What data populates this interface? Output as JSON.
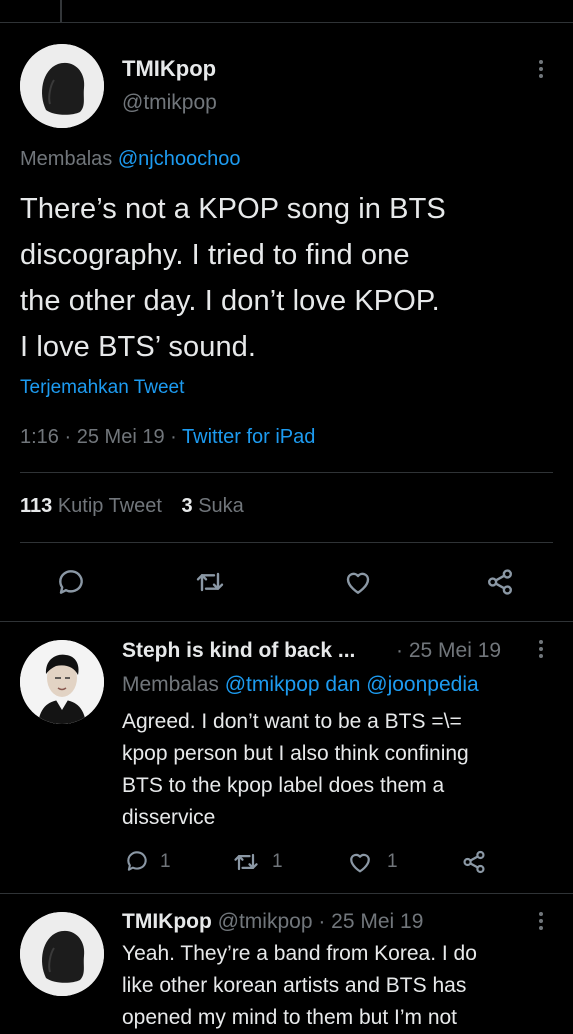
{
  "main_tweet": {
    "display_name": "TMIKpop",
    "handle": "@tmikpop",
    "replying_prefix": "Membalas",
    "replying_to": "@njchoochoo",
    "text_lines": [
      "There’s not a KPOP song in BTS",
      "discography. I tried to find one",
      "the other day.  I don’t love KPOP.",
      "I love BTS’ sound."
    ],
    "translate_label": "Terjemahkan Tweet",
    "time": "1:16",
    "date": "25 Mei 19",
    "separator": "·",
    "source": "Twitter for iPad",
    "quote_count": "113",
    "quote_label": "Kutip Tweet",
    "like_count": "3",
    "like_label": "Suka"
  },
  "replies": [
    {
      "display_name": "Steph is kind of back ...",
      "date": "· 25 Mei 19",
      "replying_prefix": "Membalas",
      "replying_to": "@tmikpop dan @joonpedia",
      "text_lines": [
        "Agreed. I don’t want to be a BTS =\\=",
        "kpop person but I also think confining",
        "BTS to the kpop label does them a",
        "disservice"
      ],
      "reply_count": "1",
      "retweet_count": "1",
      "like_count": "1"
    },
    {
      "display_name": "TMIKpop",
      "handle_date": "@tmikpop · 25 Mei 19",
      "text_lines": [
        "Yeah. They’re a band from Korea. I do",
        "like other korean artists and BTS has",
        "opened my mind to them but I’m not"
      ]
    }
  ],
  "colors": {
    "background": "#000000",
    "text": "#e7e9ea",
    "muted": "#71767b",
    "accent": "#1d9bf0",
    "divider": "#2f3336"
  },
  "icons": [
    "reply-icon",
    "retweet-icon",
    "like-icon",
    "share-icon",
    "more-icon"
  ]
}
